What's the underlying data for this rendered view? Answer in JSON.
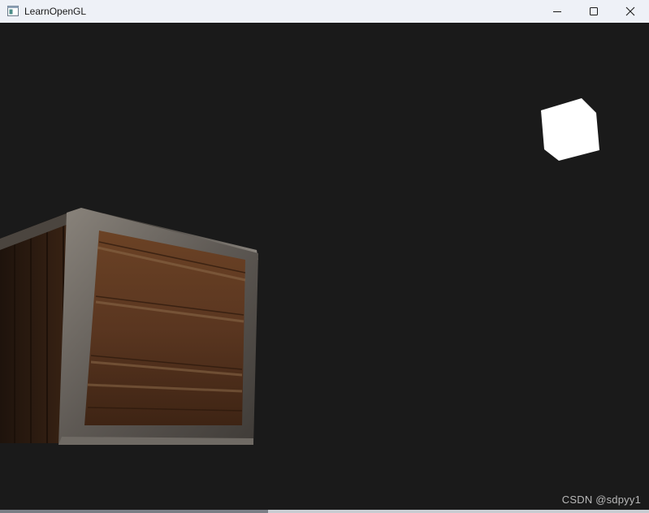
{
  "window": {
    "title": "LearnOpenGL",
    "controls": {
      "minimize": "minimize-icon",
      "maximize": "maximize-icon",
      "close": "close-icon"
    }
  },
  "scene": {
    "background_color": "#1a1a1a",
    "objects": [
      "wooden-crate",
      "light-cube"
    ]
  },
  "watermark": {
    "text": "CSDN @sdpyy1"
  }
}
